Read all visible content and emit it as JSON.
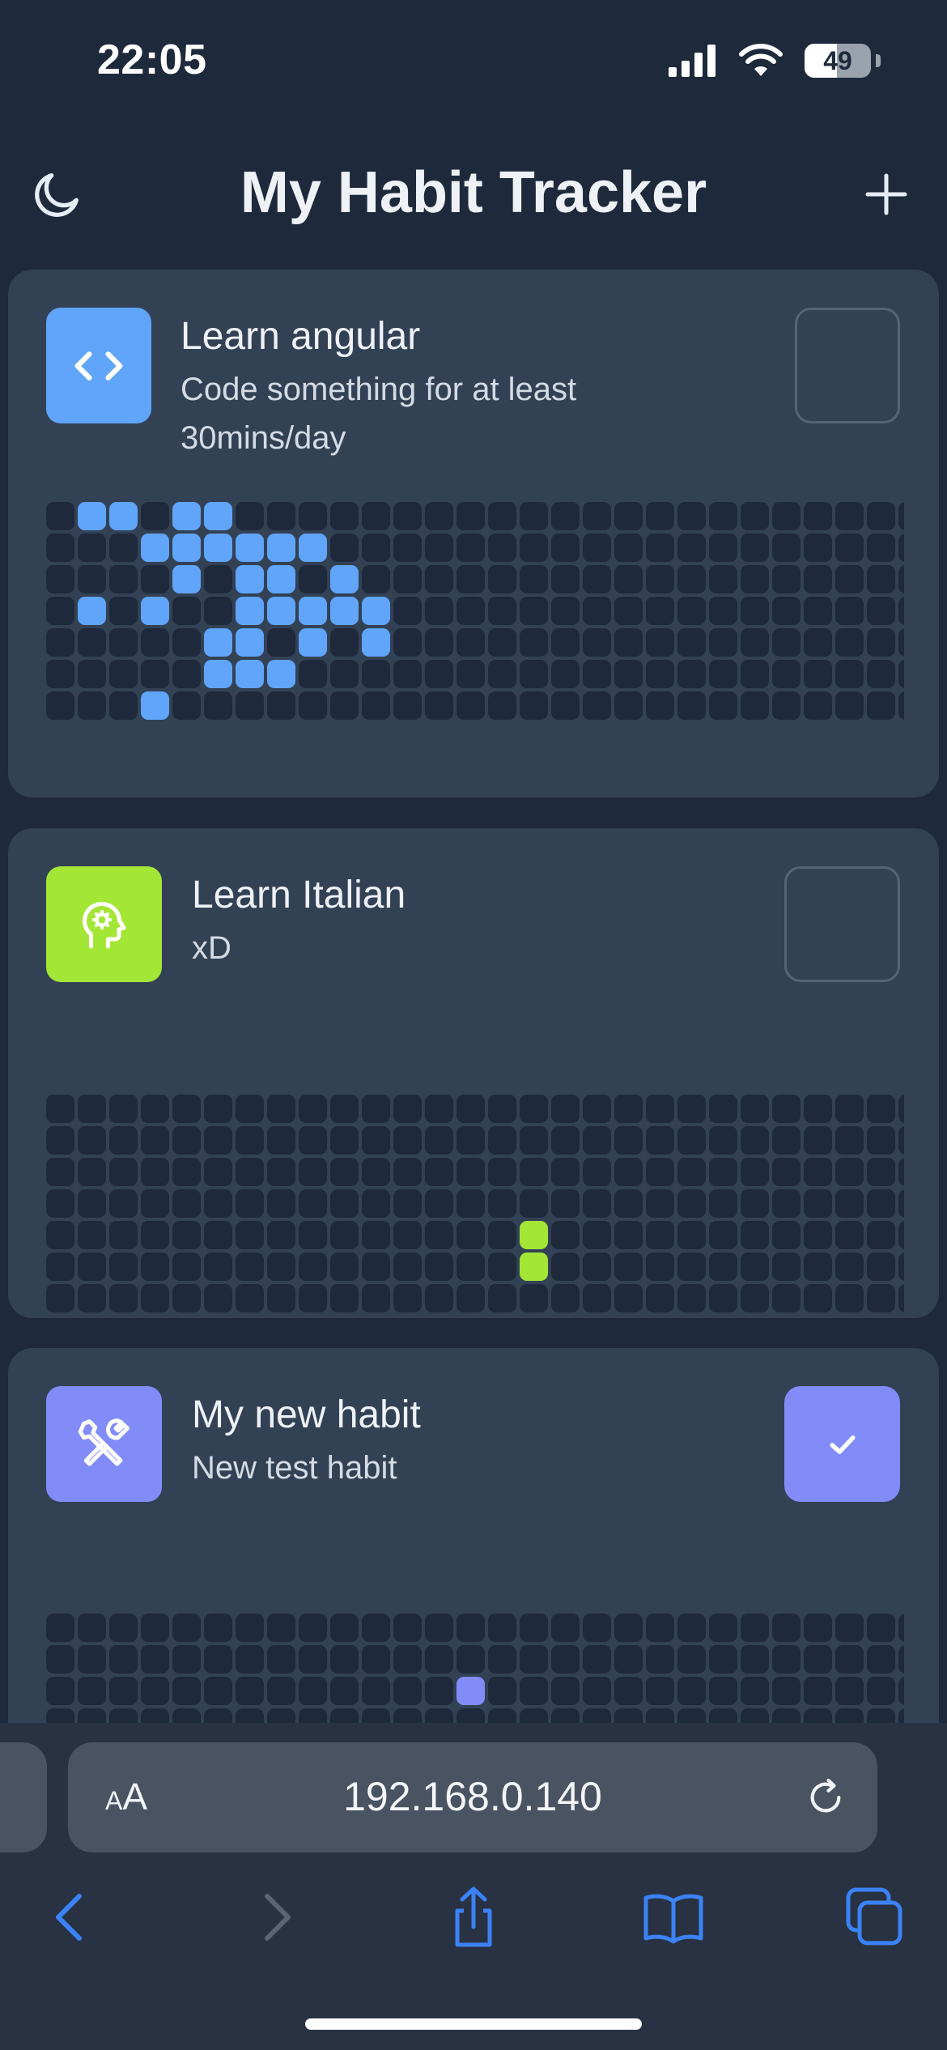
{
  "status": {
    "time": "22:05",
    "battery": "49",
    "battery_level": 0.49
  },
  "header": {
    "title": "My Habit Tracker",
    "theme_icon": "moon-icon",
    "add_icon": "plus-icon"
  },
  "habits": [
    {
      "name": "Learn angular",
      "description": "Code something for at least 30mins/day",
      "icon": "code-icon",
      "color": "#60a5fa",
      "checked": false,
      "completed_days": [
        7,
        10,
        14,
        22,
        24,
        27,
        28,
        29,
        30,
        35,
        36,
        39,
        40,
        43,
        44,
        45,
        46,
        47,
        50,
        51,
        52,
        54,
        57,
        59,
        60,
        65,
        66,
        73,
        74
      ]
    },
    {
      "name": "Learn Italian",
      "description": "xD",
      "icon": "brain-gear-icon",
      "color": "#a3e635",
      "checked": false,
      "completed_days": [
        109,
        110
      ]
    },
    {
      "name": "My new habit",
      "description": "New test habit",
      "icon": "tools-icon",
      "color": "#818cf8",
      "checked": true,
      "completed_days": [
        93
      ]
    }
  ],
  "browser": {
    "text_size_label_small": "A",
    "text_size_label_large": "A",
    "url": "192.168.0.140",
    "icons": [
      "reload-icon",
      "back-icon",
      "forward-icon",
      "share-icon",
      "bookmarks-icon",
      "tabs-icon"
    ]
  }
}
